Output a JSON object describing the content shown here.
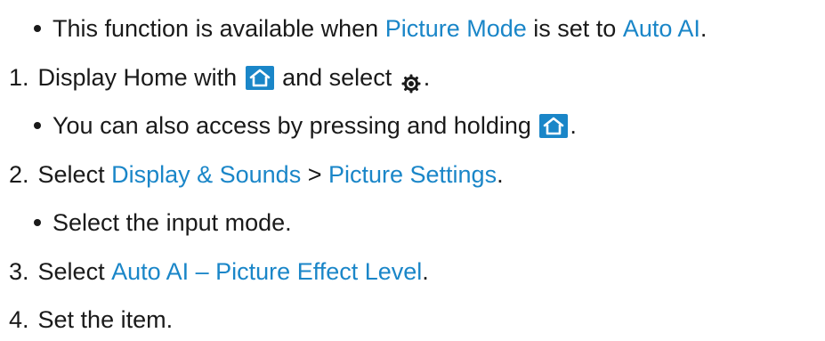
{
  "lines": {
    "note1": {
      "pre": "This function is available when ",
      "link1": "Picture Mode",
      "mid": " is set to ",
      "link2": "Auto AI",
      "post": "."
    },
    "step1": {
      "num": "1.",
      "pre": "Display Home with ",
      "mid": " and select ",
      "post": "."
    },
    "note2": {
      "pre": "You can also access by pressing and holding ",
      "post": "."
    },
    "step2": {
      "num": "2.",
      "pre": "Select ",
      "link1": "Display & Sounds",
      "mid": " > ",
      "link2": "Picture Settings",
      "post": "."
    },
    "note3": {
      "text": "Select the input mode."
    },
    "step3": {
      "num": "3.",
      "pre": "Select ",
      "link1": "Auto AI – Picture Effect Level",
      "post": "."
    },
    "step4": {
      "num": "4.",
      "text": "Set the item."
    }
  },
  "icons": {
    "home": "home-icon",
    "settings": "gear-icon"
  },
  "colors": {
    "link": "#1a86c8",
    "text": "#1a1a1a",
    "icon_bg": "#1a86c8"
  }
}
